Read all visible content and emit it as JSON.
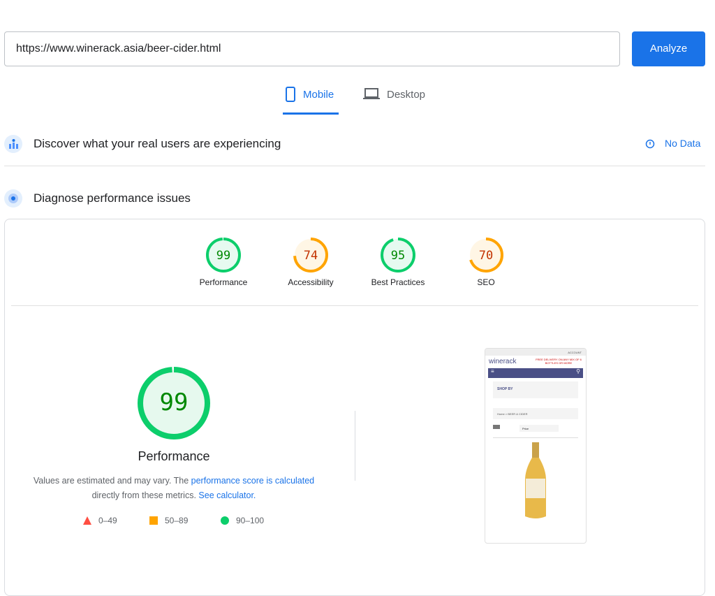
{
  "url_input": {
    "value": "https://www.winerack.asia/beer-cider.html"
  },
  "analyze_label": "Analyze",
  "tabs": [
    {
      "label": "Mobile",
      "active": true,
      "icon": "smartphone-icon"
    },
    {
      "label": "Desktop",
      "active": false,
      "icon": "laptop-icon"
    }
  ],
  "field_data": {
    "title": "Discover what your real users are experiencing",
    "status": "No Data"
  },
  "lab": {
    "title": "Diagnose performance issues"
  },
  "scores": [
    {
      "label": "Performance",
      "value": 99,
      "color": "#0cce6b",
      "text": "#008800"
    },
    {
      "label": "Accessibility",
      "value": 74,
      "color": "#ffa400",
      "text": "#c33300"
    },
    {
      "label": "Best Practices",
      "value": 95,
      "color": "#0cce6b",
      "text": "#008800"
    },
    {
      "label": "SEO",
      "value": 70,
      "color": "#ffa400",
      "text": "#c33300"
    }
  ],
  "main_score": {
    "value": 99,
    "label": "Performance"
  },
  "desc": {
    "p1": "Values are estimated and may vary. The ",
    "link1": "performance score is calculated",
    "p2": "directly from these metrics. ",
    "link2": "See calculator."
  },
  "legend": [
    {
      "range": "0–49",
      "color": "#ff4e42",
      "shape": "triangle"
    },
    {
      "range": "50–89",
      "color": "#ffa400",
      "shape": "square"
    },
    {
      "range": "90–100",
      "color": "#0cce6b",
      "shape": "circle"
    }
  ],
  "screenshot": {
    "account": "ACCOUNT",
    "logo": "winerack",
    "promo": "FREE DELIVERY ON ANY MIX OF 6 BOTTLES OR MORE",
    "shop_by": "SHOP BY",
    "breadcrumb": "Home > BEER & CIDER",
    "sort": "Price",
    "nav_color": "#4a4f86"
  }
}
